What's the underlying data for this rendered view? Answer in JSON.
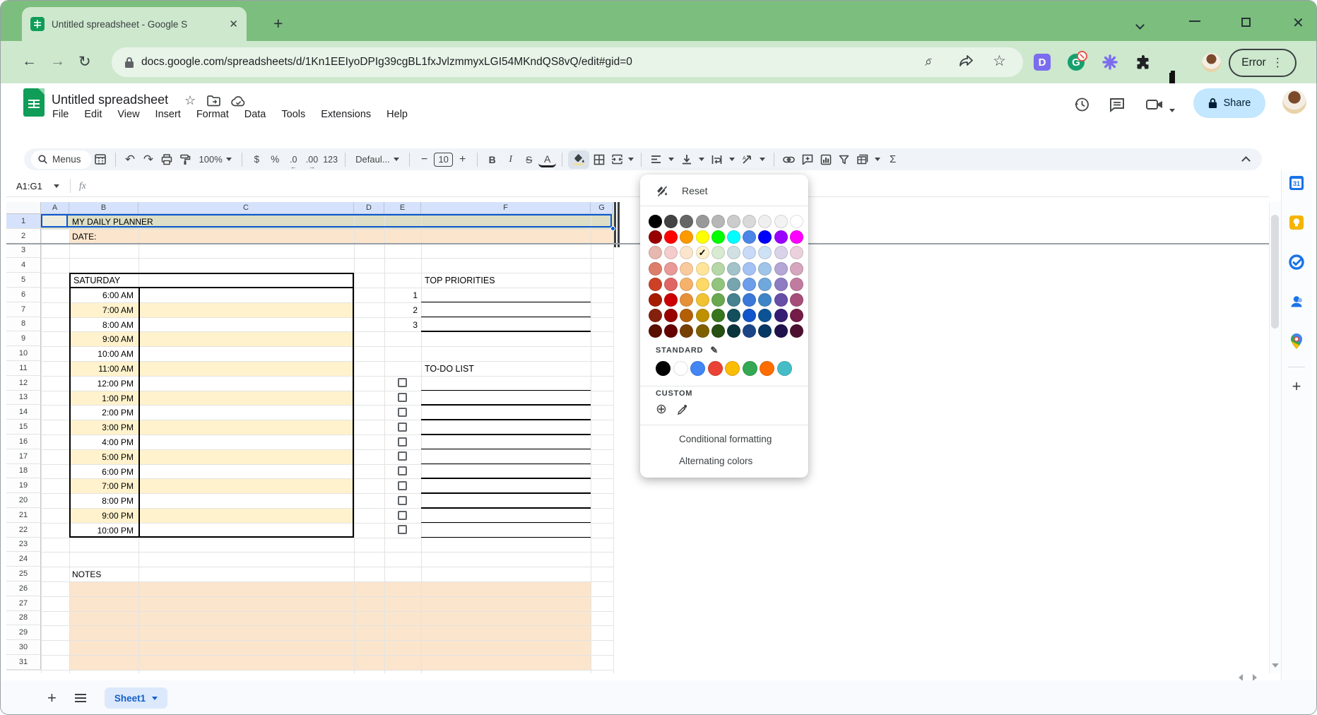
{
  "window": {
    "error_badge": "Error"
  },
  "browser_tab": {
    "title": "Untitled spreadsheet - Google S"
  },
  "address_bar": {
    "url": "docs.google.com/spreadsheets/d/1Kn1EEIyoDPIg39cgBL1fxJvlzmmyxLGI54MKndQS8vQ/edit#gid=0"
  },
  "app": {
    "doc_title": "Untitled spreadsheet",
    "menus": [
      "File",
      "Edit",
      "View",
      "Insert",
      "Format",
      "Data",
      "Tools",
      "Extensions",
      "Help"
    ],
    "share_label": "Share"
  },
  "toolbar": {
    "menus_label": "Menus",
    "zoom": "100%",
    "currency": "$",
    "percent": "%",
    "dec_dec": ".0",
    "dec_inc": ".00",
    "num_123": "123",
    "format_style": "Defaul...",
    "font_size": "10",
    "bold": "B",
    "italic": "I",
    "strike": "S",
    "text_color": "A",
    "functions": "Σ"
  },
  "formula_bar": {
    "name_box": "A1:G1",
    "fx_label": "fx"
  },
  "grid": {
    "columns": [
      "A",
      "B",
      "C",
      "D",
      "E",
      "F",
      "G"
    ],
    "row_count": 31,
    "title": "MY DAILY PLANNER",
    "date_label": "DATE:",
    "day_header": "SATURDAY",
    "times": [
      "6:00 AM",
      "7:00 AM",
      "8:00 AM",
      "9:00 AM",
      "10:00 AM",
      "11:00 AM",
      "12:00 PM",
      "1:00 PM",
      "2:00 PM",
      "3:00 PM",
      "4:00 PM",
      "5:00 PM",
      "6:00 PM",
      "7:00 PM",
      "8:00 PM",
      "9:00 PM",
      "10:00 PM"
    ],
    "priorities_title": "TOP PRIORITIES",
    "priorities_numbers": [
      "1",
      "2",
      "3"
    ],
    "todo_title": "TO-DO LIST",
    "todo_row_count": 11,
    "notes_label": "NOTES",
    "fill_colors": {
      "shaded_row": "#fff2cc",
      "banner": "#fce5cd",
      "title_row": "#dcdfc5",
      "selection": "#0b57d0"
    }
  },
  "color_picker": {
    "reset_label": "Reset",
    "palette": [
      [
        "#000000",
        "#434343",
        "#666666",
        "#999999",
        "#b7b7b7",
        "#cccccc",
        "#d9d9d9",
        "#efefef",
        "#f3f3f3",
        "#ffffff"
      ],
      [
        "#980000",
        "#ff0000",
        "#ff9900",
        "#ffff00",
        "#00ff00",
        "#00ffff",
        "#4a86e8",
        "#0000ff",
        "#9900ff",
        "#ff00ff"
      ],
      [
        "#e6b8af",
        "#f4cccc",
        "#fce5cd",
        "#fff2cc",
        "#d9ead3",
        "#d0e0e3",
        "#c9daf8",
        "#cfe2f3",
        "#d9d2e9",
        "#ead1dc"
      ],
      [
        "#dd7e6b",
        "#ea9999",
        "#f9cb9c",
        "#ffe599",
        "#b6d7a8",
        "#a2c4c9",
        "#a4c2f4",
        "#9fc5e8",
        "#b4a7d6",
        "#d5a6bd"
      ],
      [
        "#cc4125",
        "#e06666",
        "#f6b26b",
        "#ffd966",
        "#93c47d",
        "#76a5af",
        "#6d9eeb",
        "#6fa8dc",
        "#8e7cc3",
        "#c27ba0"
      ],
      [
        "#a61c00",
        "#cc0000",
        "#e69138",
        "#f1c232",
        "#6aa84f",
        "#45818e",
        "#3c78d8",
        "#3d85c6",
        "#674ea7",
        "#a64d79"
      ],
      [
        "#85200c",
        "#990000",
        "#b45f06",
        "#bf9000",
        "#38761d",
        "#134f5c",
        "#1155cc",
        "#0b5394",
        "#351c75",
        "#741b47"
      ],
      [
        "#5b0f00",
        "#660000",
        "#783f04",
        "#7f6000",
        "#274e13",
        "#0c343d",
        "#1c4587",
        "#073763",
        "#20124d",
        "#4c1130"
      ]
    ],
    "selected": {
      "row": 2,
      "col": 3,
      "hex": "#fff2cc"
    },
    "standard_label": "STANDARD",
    "standard_colors": [
      "#000000",
      "#ffffff",
      "#4285f4",
      "#ea4335",
      "#fbbc04",
      "#34a853",
      "#ff6d01",
      "#46bdc6"
    ],
    "custom_label": "CUSTOM",
    "items": [
      "Conditional formatting",
      "Alternating colors"
    ]
  },
  "sheet_bar": {
    "active_sheet": "Sheet1"
  }
}
